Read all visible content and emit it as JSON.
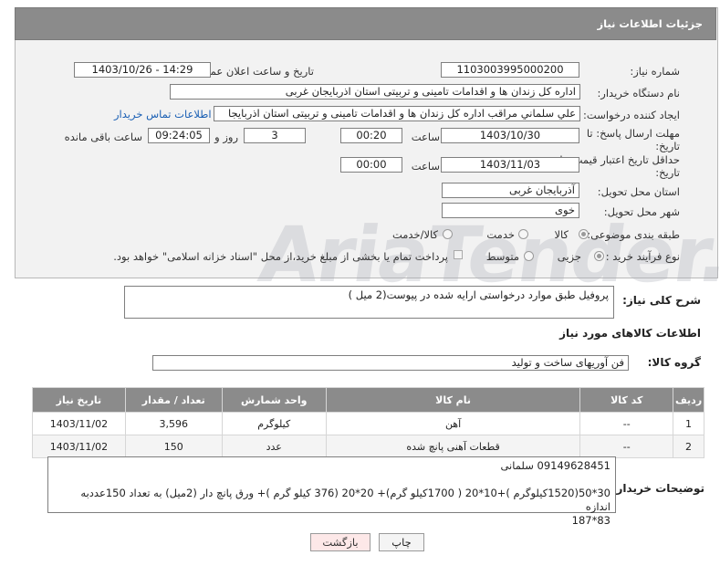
{
  "header": {
    "title": "جزئیات اطلاعات نیاز"
  },
  "form": {
    "need_number_label": "شماره نیاز:",
    "need_number": "1103003995000200",
    "announce_label": "تاریخ و ساعت اعلان عمومی:",
    "announce_value": "1403/10/26 - 14:29",
    "buyer_org_label": "نام دستگاه خریدار:",
    "buyer_org": "اداره کل زندان ها و اقدامات تامینی و تربیتی استان اذربایجان غربی",
    "requester_label": "ایجاد کننده درخواست:",
    "requester": "علي سلماني مراقب اداره کل زندان ها و اقدامات تامینی و تربیتی استان اذربایجا",
    "contact_link": "اطلاعات تماس خریدار",
    "deadline_label_line1": "مهلت ارسال پاسخ: تا",
    "deadline_label_line2": "تاریخ:",
    "deadline_date": "1403/10/30",
    "time_label": "ساعت",
    "deadline_time": "00:20",
    "days_count": "3",
    "days_label": "روز و",
    "remaining_time": "09:24:05",
    "remaining_label": "ساعت باقی مانده",
    "validity_label_line1": "حداقل تاریخ اعتبار قیمت: تا",
    "validity_label_line2": "تاریخ:",
    "validity_date": "1403/11/03",
    "validity_time": "00:00",
    "province_label": "استان محل تحویل:",
    "province": "آذربایجان غربی",
    "city_label": "شهر محل تحویل:",
    "city": "خوی",
    "category_label": "طبقه بندی موضوعی:",
    "category_options": [
      "کالا",
      "خدمت",
      "کالا/خدمت"
    ],
    "process_label": "نوع فرآیند خرید :",
    "process_options": [
      "جزیی",
      "متوسط"
    ],
    "treasury_note": "پرداخت تمام یا بخشی از مبلغ خرید،از محل \"اسناد خزانه اسلامی\" خواهد بود."
  },
  "description": {
    "label": "شرح کلی نیاز:",
    "value": "پروفیل طبق موارد درخواستی ارایه شده در پیوست(2 میل )"
  },
  "goods_section_title": "اطلاعات کالاهای مورد نیاز",
  "goods_group": {
    "label": "گروه کالا:",
    "value": "فن آوریهای ساخت و تولید"
  },
  "table": {
    "headers": [
      "ردیف",
      "کد کالا",
      "نام کالا",
      "واحد شمارش",
      "تعداد / مقدار",
      "تاریخ نیاز"
    ],
    "rows": [
      [
        "1",
        "--",
        "آهن",
        "کیلوگرم",
        "3,596",
        "1403/11/02"
      ],
      [
        "2",
        "--",
        "قطعات آهنی پانچ شده",
        "عدد",
        "150",
        "1403/11/02"
      ]
    ]
  },
  "buyer_notes": {
    "label": "توضیحات خریدار:",
    "line1": "09149628451  سلمانی",
    "line2": "30*50(1520کیلوگرم )+10*20 ( 1700کیلو گرم)+ 20*20 (376 کیلو گرم )+ ورق پانچ دار (2میل) به تعداد  150عددبه اندازه",
    "line3": "83*187"
  },
  "buttons": {
    "print": "چاپ",
    "back": "بازگشت"
  },
  "watermark": "AriaTender.neT"
}
